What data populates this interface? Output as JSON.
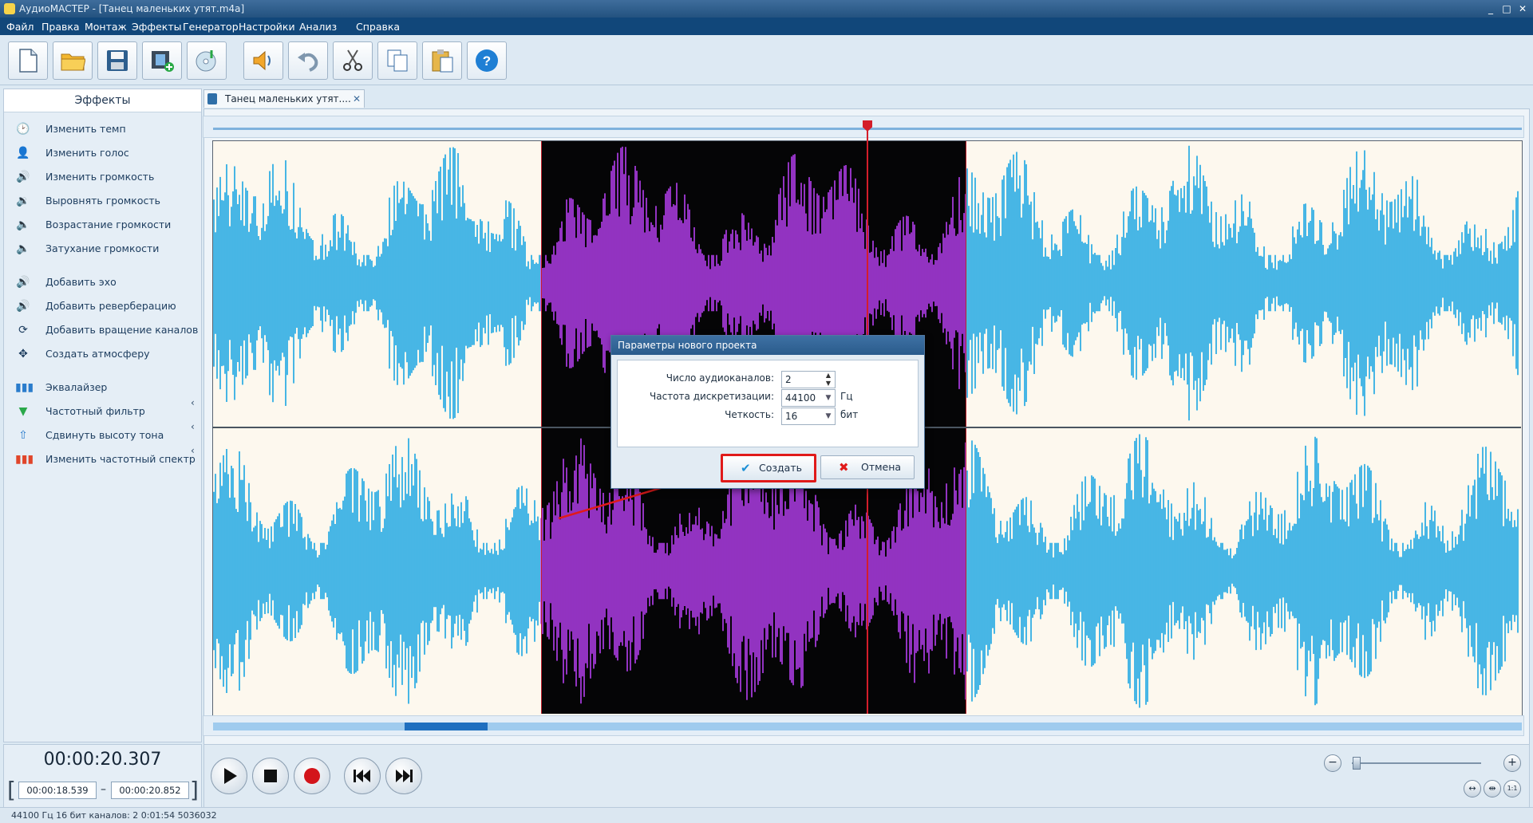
{
  "window": {
    "title": "АудиоМАСТЕР - [Танец маленьких утят.m4a]",
    "controls": [
      "_",
      "□",
      "✕"
    ]
  },
  "menu": [
    "Файл",
    "Правка",
    "Монтаж",
    "Эффекты",
    "Генератор",
    "Настройки",
    "Анализ",
    "Справка"
  ],
  "toolbar": {
    "buttons": [
      "new-file-icon",
      "open-folder-icon",
      "save-icon",
      "add-video-icon",
      "audio-cd-icon",
      "effects-icon",
      "undo-icon",
      "cut-icon",
      "copy-icon",
      "paste-icon",
      "help-icon"
    ]
  },
  "sidebar": {
    "title": "Эффекты",
    "groups": [
      [
        "Изменить темп",
        "Изменить голос",
        "Изменить громкость",
        "Выровнять громкость",
        "Возрастание громкости",
        "Затухание громкости"
      ],
      [
        "Добавить эхо",
        "Добавить реверберацию",
        "Добавить вращение каналов",
        "Создать атмосферу"
      ],
      [
        "Эквалайзер",
        "Частотный фильтр",
        "Сдвинуть высоту тона",
        "Изменить частотный спектр"
      ]
    ],
    "arrow": "‹"
  },
  "editor": {
    "tab": {
      "label": "Танец маленьких утят....",
      "close": "✕"
    },
    "accent": "#1aa6e3",
    "selection_color": "#b63ff0"
  },
  "dialog": {
    "title": "Параметры нового проекта",
    "fields": {
      "channels": {
        "label": "Число аудиоканалов:",
        "value": "2"
      },
      "rate": {
        "label": "Частота дискретизации:",
        "value": "44100",
        "unit": "Гц"
      },
      "depth": {
        "label": "Четкость:",
        "value": "16",
        "unit": "бит"
      }
    },
    "create": "Создать",
    "cancel": "Отмена"
  },
  "transport": {
    "current_time": "00:00:20.307",
    "sel_start": "00:00:18.539",
    "sel_end": "00:00:20.852",
    "dash": "–",
    "bracket_left": "[",
    "bracket_right": "]",
    "zoom_minus": "−",
    "zoom_plus": "+",
    "zoom_level": 0.03
  },
  "status": "44100 Гц  16 бит  каналов: 2   0:01:54 5036032"
}
